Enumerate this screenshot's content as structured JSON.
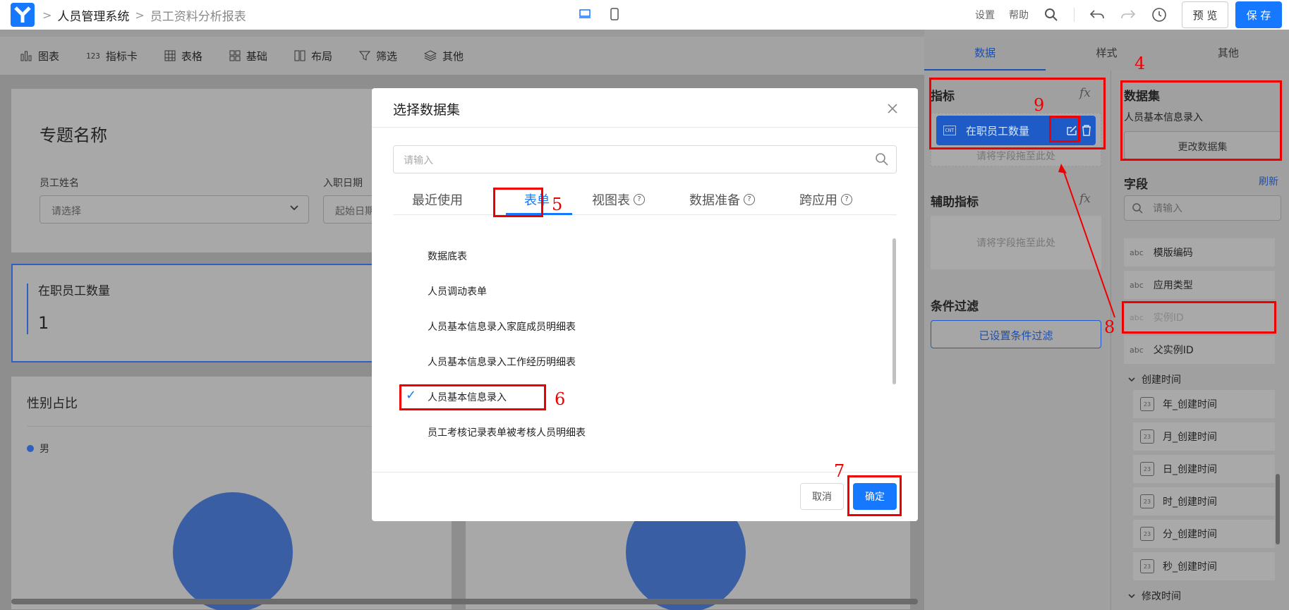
{
  "header": {
    "breadcrumb": [
      "人员管理系统",
      "员工资料分析报表"
    ],
    "links": [
      "设置",
      "帮助"
    ],
    "preview_label": "预 览",
    "save_label": "保 存"
  },
  "toolbar": {
    "items": [
      {
        "label": "图表",
        "icon": "bar-chart-icon"
      },
      {
        "label": "指标卡",
        "icon": "metric-card-icon",
        "prefix": "123"
      },
      {
        "label": "表格",
        "icon": "table-icon"
      },
      {
        "label": "基础",
        "icon": "basic-icon"
      },
      {
        "label": "布局",
        "icon": "layout-icon"
      },
      {
        "label": "筛选",
        "icon": "filter-icon"
      },
      {
        "label": "其他",
        "icon": "layers-icon"
      }
    ]
  },
  "canvas": {
    "topic_title": "专题名称",
    "filter1_label": "员工姓名",
    "filter1_placeholder": "请选择",
    "filter2_label": "入职日期",
    "filter2_placeholder": "起始日期",
    "kpi_title": "在职员工数量",
    "kpi_value": "1",
    "pie_title": "性别占比",
    "legend_item": "男"
  },
  "modal": {
    "title": "选择数据集",
    "search_placeholder": "请输入",
    "tabs": [
      "最近使用",
      "表单",
      "视图表",
      "数据准备",
      "跨应用"
    ],
    "active_tab": "表单",
    "items": [
      "数据底表",
      "人员调动表单",
      "人员基本信息录入家庭成员明细表",
      "人员基本信息录入工作经历明细表",
      "人员基本信息录入",
      "员工考核记录表单被考核人员明细表"
    ],
    "selected_item": "人员基本信息录入",
    "cancel_label": "取消",
    "ok_label": "确定"
  },
  "right_panel": {
    "tabs": [
      "数据",
      "样式",
      "其他"
    ],
    "active_tab": "数据",
    "metric_section": "指标",
    "metric_chip": "在职员工数量",
    "metric_chip_badge": "CNT",
    "drop_hint": "请将字段拖至此处",
    "aux_section": "辅助指标",
    "filter_section": "条件过滤",
    "filter_button": "已设置条件过滤",
    "dataset_section": "数据集",
    "dataset_name": "人员基本信息录入",
    "change_dataset": "更改数据集",
    "fields_section": "字段",
    "refresh": "刷新",
    "field_search_placeholder": "请输入",
    "fields": [
      {
        "type": "abc",
        "name": "模版编码"
      },
      {
        "type": "abc",
        "name": "应用类型"
      },
      {
        "type": "abc",
        "name": "实例ID"
      },
      {
        "type": "abc",
        "name": "父实例ID"
      }
    ],
    "group1": "创建时间",
    "date_fields": [
      "年_创建时间",
      "月_创建时间",
      "日_创建时间",
      "时_创建时间",
      "分_创建时间",
      "秒_创建时间"
    ],
    "group2": "修改时间"
  },
  "annotations": [
    "4",
    "5",
    "6",
    "7",
    "8",
    "9"
  ],
  "colors": {
    "primary": "#1677ff",
    "annotation": "#e00000",
    "chip": "#1e5bc6"
  }
}
